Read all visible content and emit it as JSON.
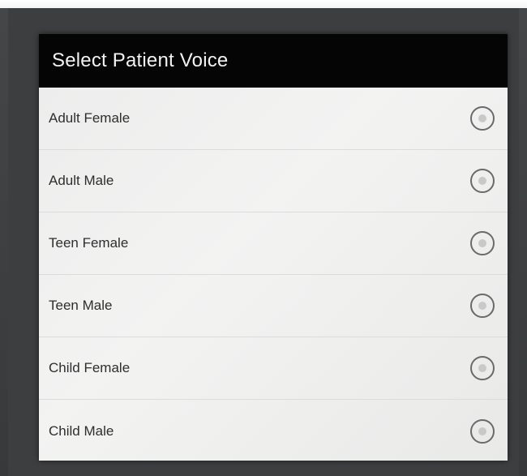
{
  "dialog": {
    "title": "Select Patient Voice",
    "options": [
      {
        "label": "Adult Female",
        "selected": false
      },
      {
        "label": "Adult Male",
        "selected": false
      },
      {
        "label": "Teen Female",
        "selected": false
      },
      {
        "label": "Teen Male",
        "selected": false
      },
      {
        "label": "Child Female",
        "selected": false
      },
      {
        "label": "Child Male",
        "selected": false
      }
    ]
  },
  "colors": {
    "header_background": "#050505",
    "header_text": "#f2f2f2",
    "dialog_background": "#eeeeed",
    "radio_stroke": "#6a6a6a",
    "radio_dot": "#c9c9c9"
  }
}
